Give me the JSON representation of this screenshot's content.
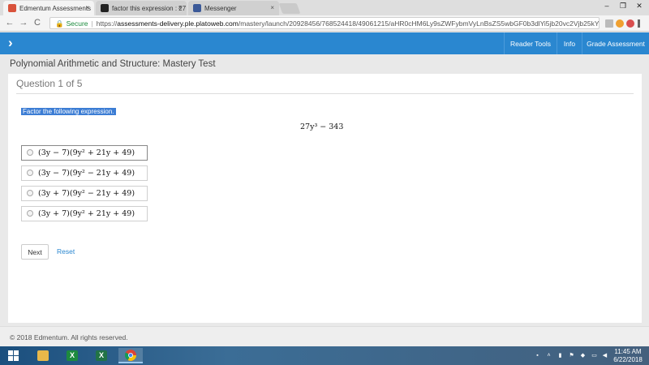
{
  "browser": {
    "tabs": [
      {
        "title": "Edmentum Assessments",
        "active": true,
        "favicon_color": "#d9533c"
      },
      {
        "title": "factor this expression : 27",
        "active": false,
        "favicon_color": "#222222"
      },
      {
        "title": "Messenger",
        "active": false,
        "favicon_color": "#3b5998"
      }
    ],
    "tab_close_glyph": "×",
    "window_controls": [
      "–",
      "❐",
      "✕"
    ],
    "nav": {
      "back": "←",
      "forward": "→",
      "reload": "C"
    },
    "address": {
      "lock_icon": "🔒",
      "secure_label": "Secure",
      "separator": "|",
      "scheme": "https://",
      "host": "assessments-delivery.ple.platoweb.com",
      "path": "/mastery/launch/20928456/768524418/49061215/aHR0cHM6Ly9sZWFybmVyLnBsZS5wbGF0b3dlYi5jb20vc2Vjb25kYXJ5L2xl..."
    },
    "toolbar_icons": [
      "star-icon",
      "extension-icon",
      "extension-icon",
      "menu-icon"
    ]
  },
  "app": {
    "brand_color": "#2a87d0",
    "menu_icon": "›",
    "menu": [
      "Reader Tools",
      "Info",
      "Grade Assessment"
    ],
    "page_title": "Polynomial Arithmetic and Structure: Mastery Test"
  },
  "question": {
    "header": "Question 1 of 5",
    "prompt": "Factor the following expression.",
    "expression": "27y³  −  343",
    "options": [
      "(3y − 7)(9y² + 21y + 49)",
      "(3y − 7)(9y² − 21y + 49)",
      "(3y + 7)(9y² − 21y + 49)",
      "(3y + 7)(9y² + 21y + 49)"
    ]
  },
  "actions": {
    "next": "Next",
    "reset": "Reset"
  },
  "footer": {
    "copyright": "© 2018 Edmentum. All rights reserved."
  },
  "taskbar": {
    "apps": [
      {
        "name": "windows-start",
        "glyph": "",
        "color": "#ffffff"
      },
      {
        "name": "file-explorer",
        "glyph": "",
        "color": "#e8b84a"
      },
      {
        "name": "excel-2007",
        "glyph": "X",
        "color": "#1d8a3e"
      },
      {
        "name": "excel",
        "glyph": "X",
        "color": "#217346"
      },
      {
        "name": "chrome",
        "glyph": "",
        "color": "#db4437"
      }
    ],
    "clock": {
      "time": "11:45 AM",
      "date": "6/22/2018"
    }
  }
}
